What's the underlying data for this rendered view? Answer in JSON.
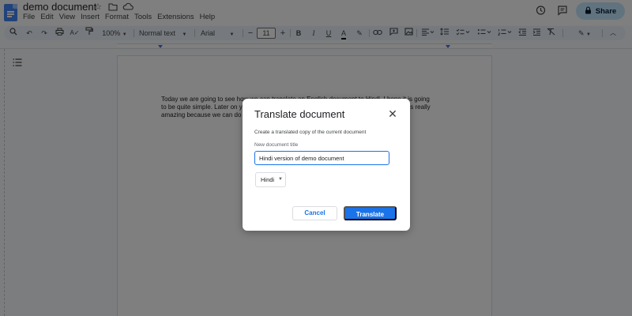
{
  "app": {
    "title": "demo document"
  },
  "menubar": [
    "File",
    "Edit",
    "View",
    "Insert",
    "Format",
    "Tools",
    "Extensions",
    "Help"
  ],
  "share": {
    "label": "Share"
  },
  "toolbar": {
    "zoom": "100%",
    "style": "Normal text",
    "font": "Arial",
    "font_size": "11",
    "minus": "−",
    "plus": "+"
  },
  "document": {
    "line1": "Today we are going to see how we can translate an English document to Hindi. I hope it is going",
    "line2": "to be quite simple. Later on you will see this document will be translated into Hindi and it is really",
    "line3": "amazing because we can do it in just a few clicks."
  },
  "dialog": {
    "title": "Translate document",
    "description": "Create a translated copy of the current document",
    "field_label": "New document title",
    "field_value": "Hindi version of demo document",
    "language": "Hindi",
    "cancel": "Cancel",
    "translate": "Translate"
  },
  "colors": {
    "accent": "#1a73e8",
    "share_bg": "#c2e7ff",
    "toolbar_bg": "#edf2fa"
  },
  "icons": [
    "docs-logo-icon",
    "star-icon",
    "folder-move-icon",
    "cloud-status-icon",
    "history-icon",
    "comment-icon",
    "lock-icon",
    "search-icon",
    "undo-icon",
    "redo-icon",
    "print-icon",
    "spellcheck-icon",
    "paint-format-icon",
    "close-icon",
    "chevron-down-icon",
    "outline-icon"
  ]
}
